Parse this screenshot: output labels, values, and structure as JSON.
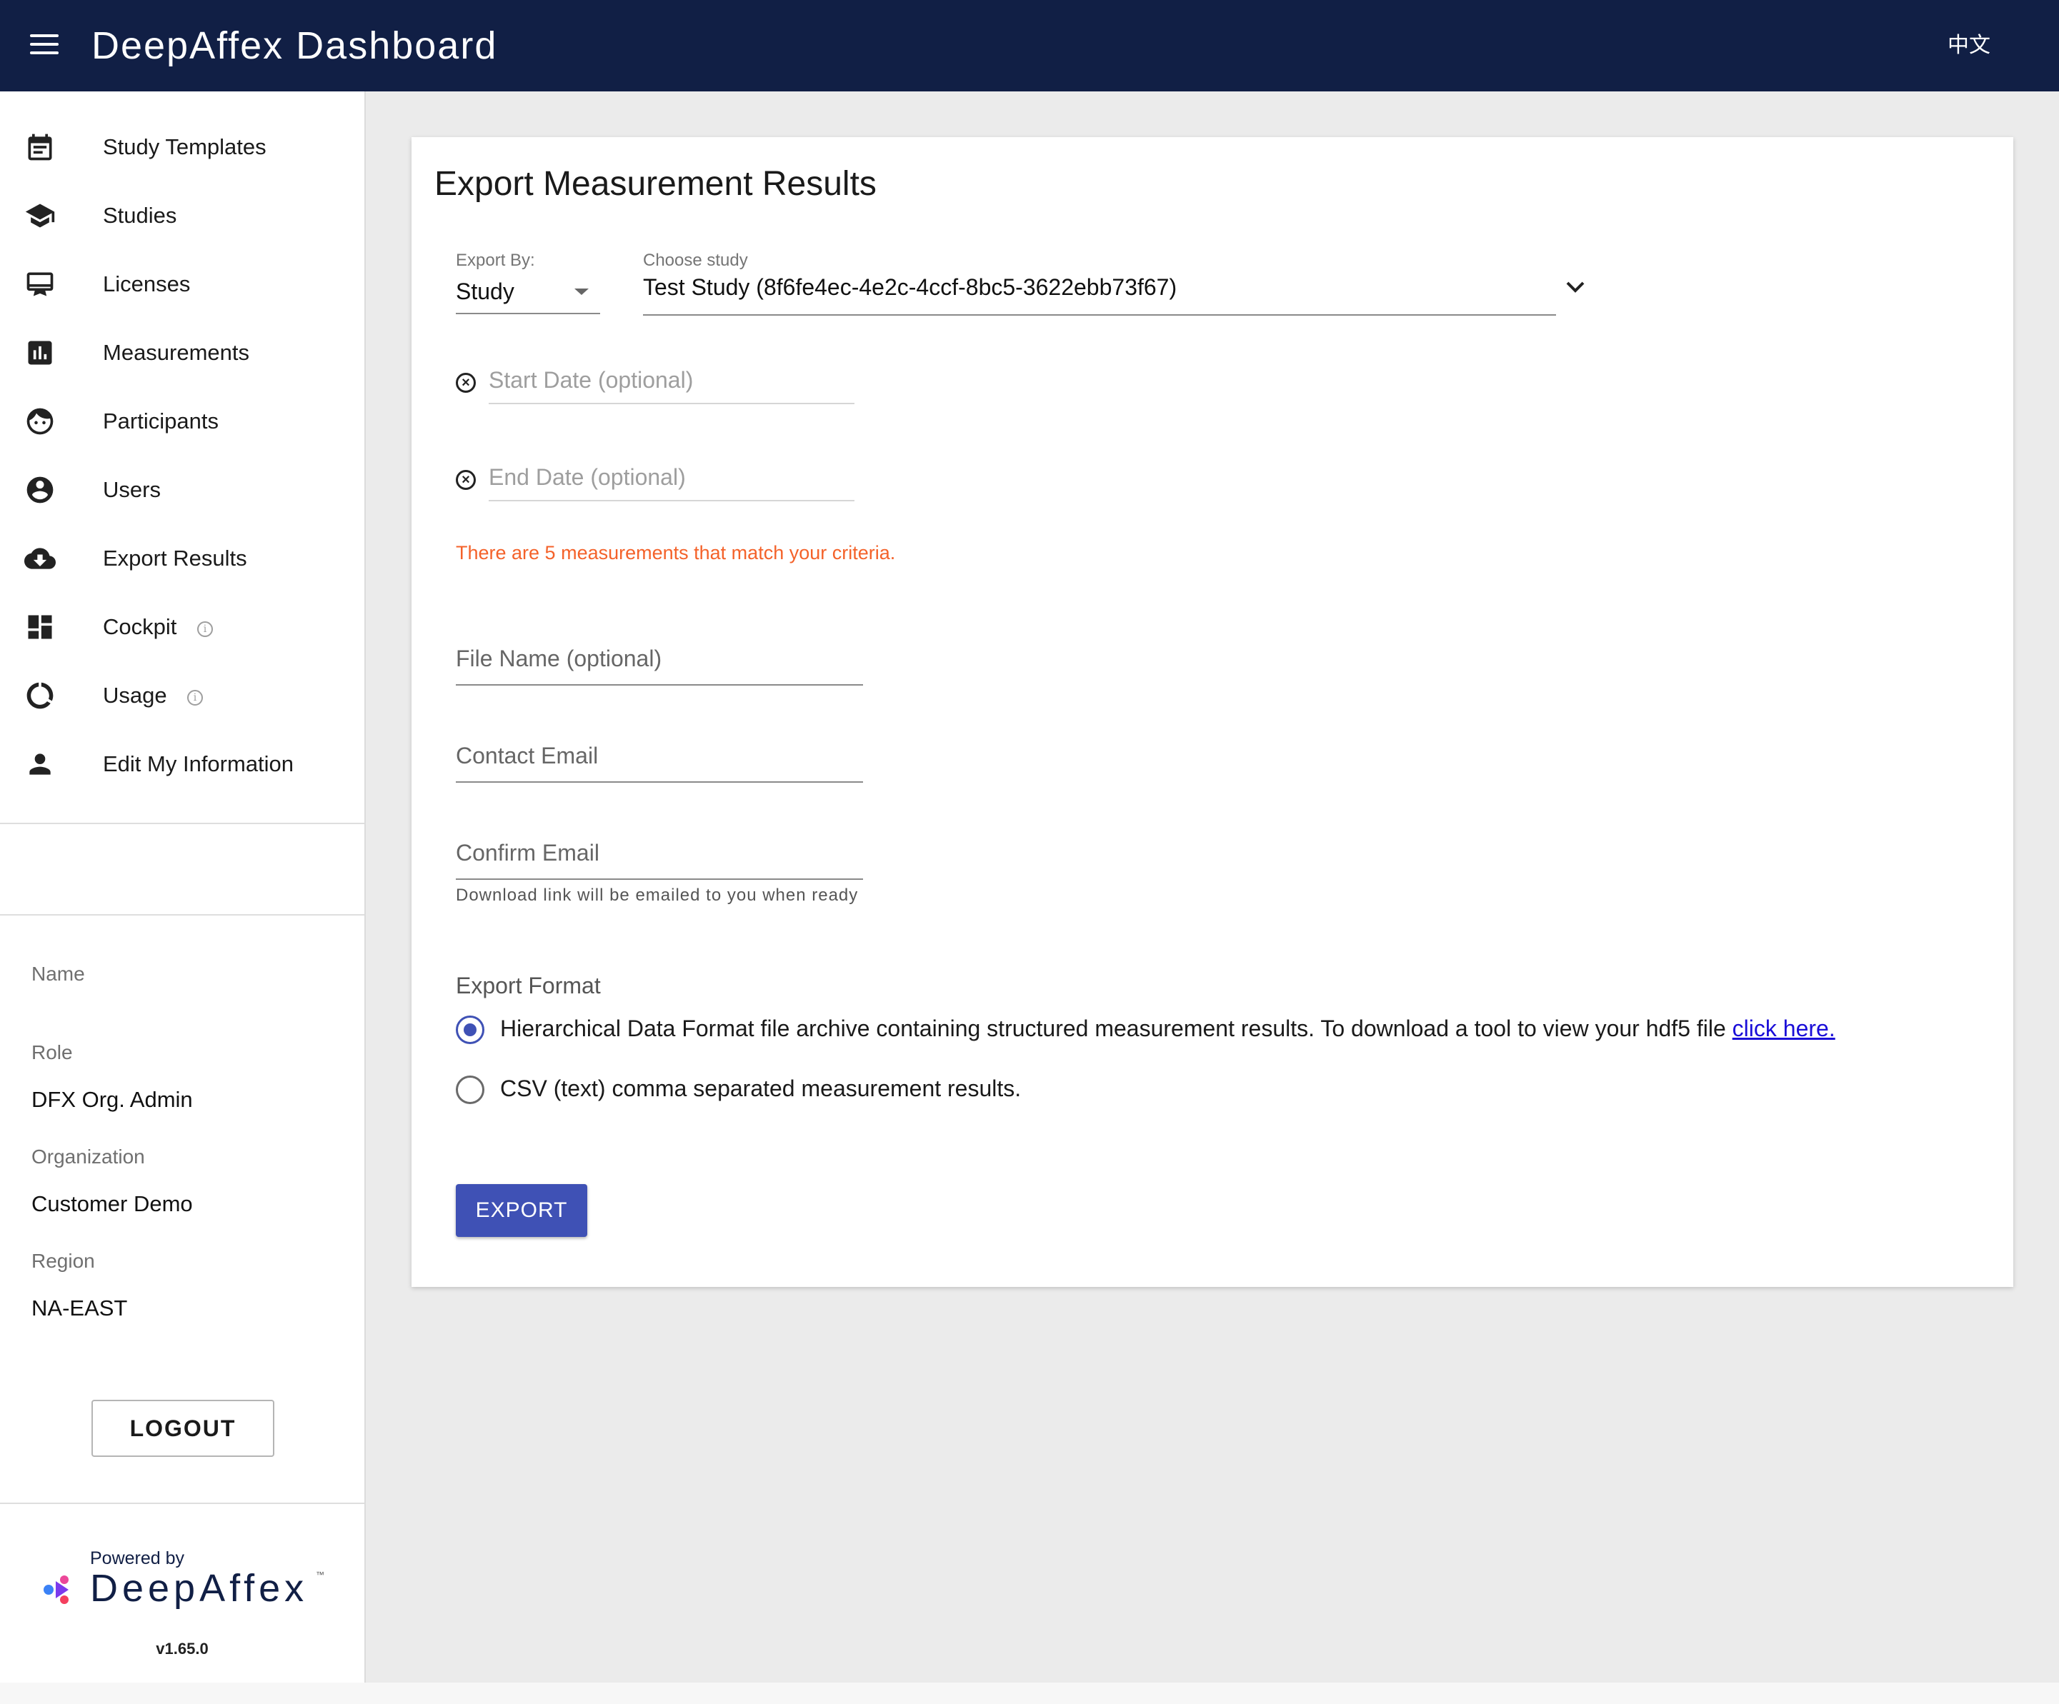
{
  "header": {
    "title": "DeepAffex Dashboard",
    "language_toggle": "中文",
    "background_color": "#111f45"
  },
  "sidebar": {
    "items": [
      {
        "label": "Study Templates",
        "icon": "calendar-icon"
      },
      {
        "label": "Studies",
        "icon": "graduation-cap-icon"
      },
      {
        "label": "Licenses",
        "icon": "license-card-icon"
      },
      {
        "label": "Measurements",
        "icon": "bar-chart-icon"
      },
      {
        "label": "Participants",
        "icon": "face-icon"
      },
      {
        "label": "Users",
        "icon": "account-circle-icon"
      },
      {
        "label": "Export Results",
        "icon": "cloud-download-icon"
      },
      {
        "label": "Cockpit",
        "icon": "dashboard-icon",
        "info": true
      },
      {
        "label": "Usage",
        "icon": "donut-chart-icon",
        "info": true
      },
      {
        "label": "Edit My Information",
        "icon": "person-icon"
      }
    ],
    "user": {
      "name_label": "Name",
      "name_value": "",
      "role_label": "Role",
      "role_value": "DFX Org. Admin",
      "organization_label": "Organization",
      "organization_value": "Customer Demo",
      "region_label": "Region",
      "region_value": "NA-EAST"
    },
    "logout_label": "LOGOUT",
    "powered_by": "Powered by",
    "brand": "DeepAffex",
    "brand_tm": "™",
    "version": "v1.65.0"
  },
  "export": {
    "title": "Export Measurement Results",
    "export_by": {
      "label": "Export By:",
      "value": "Study"
    },
    "choose_study": {
      "label": "Choose study",
      "value": "Test Study (8f6fe4ec-4e2c-4ccf-8bc5-3622ebb73f67)"
    },
    "start_date_placeholder": "Start Date (optional)",
    "end_date_placeholder": "End Date (optional)",
    "match_note": "There are 5 measurements that match your criteria.",
    "file_name_placeholder": "File Name (optional)",
    "contact_email_placeholder": "Contact Email",
    "confirm_email_placeholder": "Confirm Email",
    "helper_text": "Download link will be emailed to you when ready",
    "format_heading": "Export Format",
    "formats": [
      {
        "label": "Hierarchical Data Format file archive containing structured measurement results. To download a tool to view your hdf5 file ",
        "link": "click here.",
        "selected": true
      },
      {
        "label": "CSV (text) comma separated measurement results.",
        "selected": false
      }
    ],
    "export_button": "EXPORT",
    "accent_color": "#3f51b5",
    "note_color": "#f4622a"
  }
}
